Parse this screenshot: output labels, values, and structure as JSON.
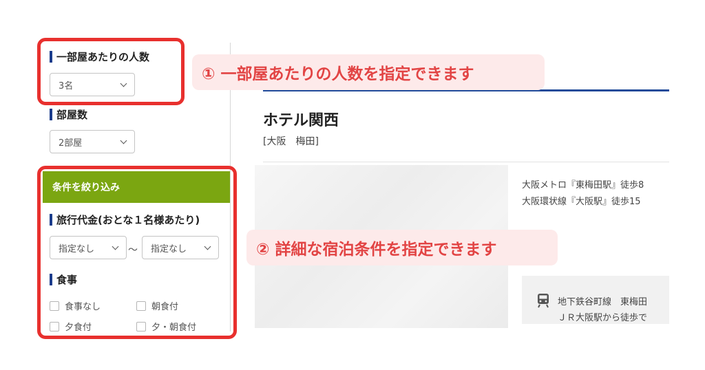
{
  "sidebar": {
    "guests_per_room": {
      "title": "一部屋あたりの人数",
      "selected": "3名"
    },
    "rooms": {
      "title": "部屋数",
      "selected": "2部屋"
    },
    "filter_header": "条件を絞り込み",
    "price": {
      "title": "旅行代金(おとな１名様あたり)",
      "min": "指定なし",
      "separator": "～",
      "max": "指定なし"
    },
    "meals": {
      "title": "食事",
      "options": [
        "食事なし",
        "朝食付",
        "夕食付",
        "夕・朝食付"
      ]
    }
  },
  "callouts": {
    "first": "① 一部屋あたりの人数を指定できます",
    "second": "② 詳細な宿泊条件を指定できます"
  },
  "hotel": {
    "name": "ホテル関西",
    "area": "[大阪　梅田]",
    "access": [
      "大阪メトロ『東梅田駅』徒歩8",
      "大阪環状線『大阪駅』徒歩15"
    ],
    "route": [
      "地下鉄谷町線　東梅田",
      "ＪＲ大阪駅から徒歩で"
    ]
  },
  "colors": {
    "accent_red": "#e8302e",
    "filter_green": "#7ba611",
    "brand_blue": "#1f4a9a"
  },
  "icons": {
    "route_icon": "train-icon"
  }
}
